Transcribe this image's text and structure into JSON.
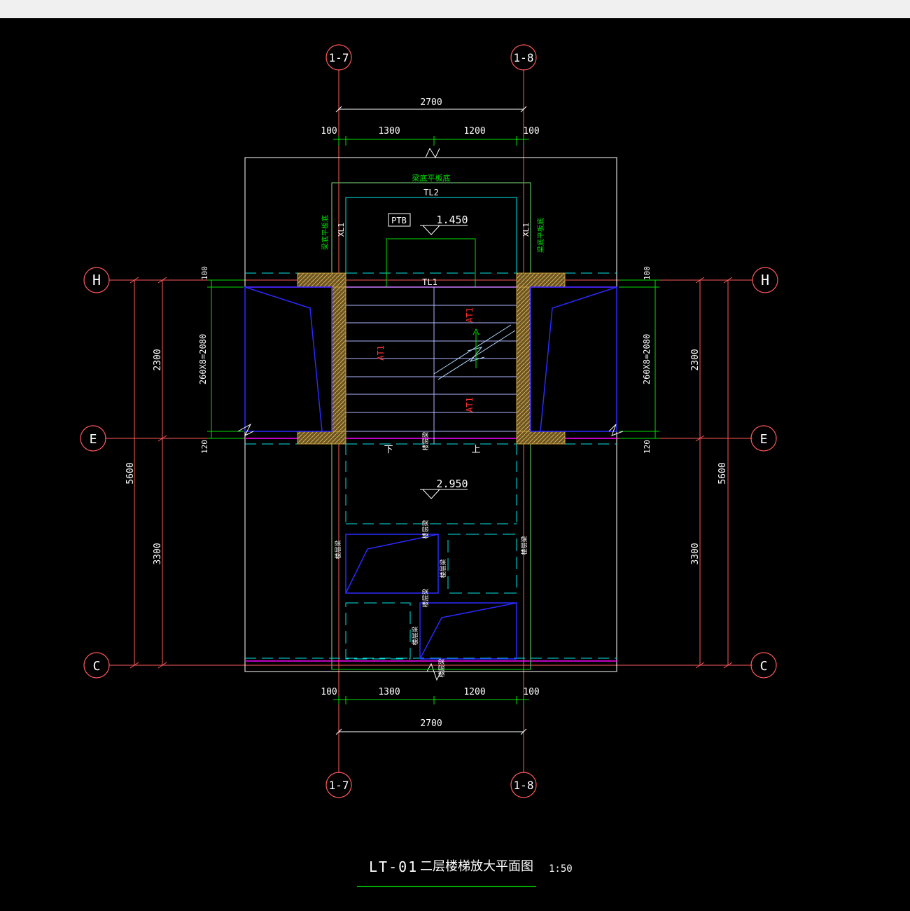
{
  "drawing": {
    "title": "LT-01",
    "subtitle": "二层楼梯放大平面图",
    "scale": "1:50"
  },
  "axes": {
    "col_left": "1-7",
    "col_right": "1-8",
    "row_top": "H",
    "row_mid": "E",
    "row_bottom": "C"
  },
  "dims": {
    "total_width": "2700",
    "left_offset": "100",
    "span_a": "1300",
    "span_b": "1200",
    "right_offset": "100",
    "left_h_offset": "100",
    "step_run": "260X8=2080",
    "left_e_offset": "120",
    "seg_he": "2300",
    "seg_ec": "3300",
    "total_height": "5600"
  },
  "labels": {
    "ptb": "PTB",
    "elev_landing": "1.450",
    "elev_floor": "2.950",
    "tl2": "TL2",
    "tl1": "TL1",
    "xl1": "XL1",
    "at1": "AT1",
    "beam_note_top": "梁底平板底",
    "beam_note_side": "梁底平板底",
    "floor_beam": "楼层梁",
    "down": "下",
    "up": "上"
  },
  "colors": {
    "axis": "#ff5a5a",
    "dim": "#00e000",
    "wall": "#1a1aff",
    "cyan": "#00e6e6",
    "magenta": "#ff00ff",
    "white": "#ffffff",
    "hatch": "#c8a040",
    "red": "#ff3030",
    "stair": "#b0b8ff"
  }
}
